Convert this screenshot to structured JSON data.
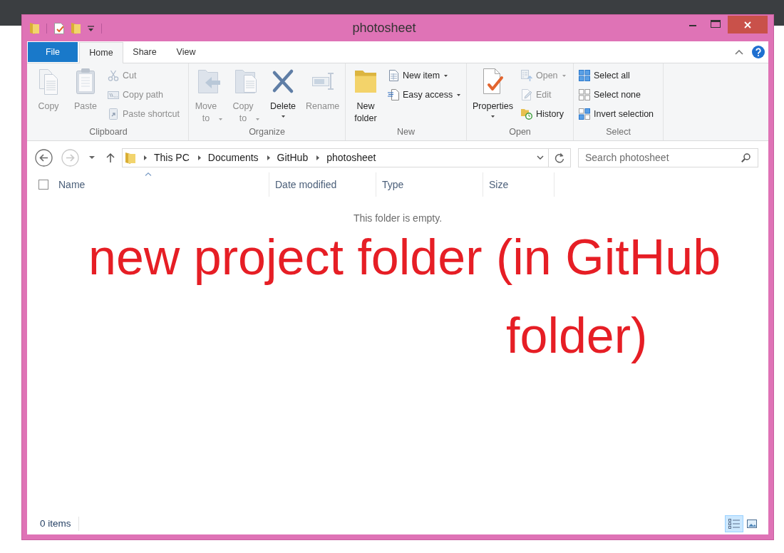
{
  "window": {
    "title": "photosheet"
  },
  "tabs": [
    {
      "label": "File",
      "kind": "file",
      "selected": false
    },
    {
      "label": "Home",
      "kind": "tab",
      "selected": true
    },
    {
      "label": "Share",
      "kind": "tab",
      "selected": false
    },
    {
      "label": "View",
      "kind": "tab",
      "selected": false
    }
  ],
  "ribbon": {
    "groups": [
      {
        "label": "Clipboard",
        "columns": [
          {
            "kind": "large",
            "label": "Copy",
            "disabled": true
          },
          {
            "kind": "large",
            "label": "Paste",
            "disabled": true
          },
          {
            "kind": "stack",
            "items": [
              {
                "label": "Cut",
                "disabled": true,
                "dropdown": false
              },
              {
                "label": "Copy path",
                "disabled": true,
                "dropdown": false
              },
              {
                "label": "Paste shortcut",
                "disabled": true,
                "dropdown": false
              }
            ]
          }
        ]
      },
      {
        "label": "Organize",
        "columns": [
          {
            "kind": "dropdown",
            "label": "Move to",
            "disabled": true
          },
          {
            "kind": "dropdown",
            "label": "Copy to",
            "disabled": true
          },
          {
            "kind": "split",
            "label": "Delete",
            "disabled": false
          },
          {
            "kind": "large",
            "label": "Rename",
            "disabled": true
          }
        ]
      },
      {
        "label": "New",
        "columns": [
          {
            "kind": "large",
            "label": "New folder",
            "disabled": false
          },
          {
            "kind": "stack",
            "items": [
              {
                "label": "New item",
                "disabled": false,
                "dropdown": true
              },
              {
                "label": "Easy access",
                "disabled": false,
                "dropdown": true
              }
            ]
          }
        ]
      },
      {
        "label": "Open",
        "columns": [
          {
            "kind": "split",
            "label": "Properties",
            "disabled": false
          },
          {
            "kind": "stack",
            "items": [
              {
                "label": "Open",
                "disabled": true,
                "dropdown": true
              },
              {
                "label": "Edit",
                "disabled": true,
                "dropdown": false
              },
              {
                "label": "History",
                "disabled": false,
                "dropdown": false
              }
            ]
          }
        ]
      },
      {
        "label": "Select",
        "columns": [
          {
            "kind": "stack",
            "items": [
              {
                "label": "Select all",
                "disabled": false,
                "dropdown": false
              },
              {
                "label": "Select none",
                "disabled": false,
                "dropdown": false
              },
              {
                "label": "Invert selection",
                "disabled": false,
                "dropdown": false
              }
            ]
          }
        ]
      }
    ]
  },
  "navigation": {
    "back": {
      "disabled": false
    },
    "forward": {
      "disabled": true
    }
  },
  "address": {
    "breadcrumbs": [
      "This PC",
      "Documents",
      "GitHub",
      "photosheet"
    ]
  },
  "search": {
    "placeholder": "Search photosheet"
  },
  "file_list": {
    "select_all": {
      "checked": false
    },
    "columns": [
      {
        "label": "Name",
        "sorted": true
      },
      {
        "label": "Date modified",
        "sorted": false
      },
      {
        "label": "Type",
        "sorted": false
      },
      {
        "label": "Size",
        "sorted": false
      }
    ],
    "empty_message": "This folder is empty."
  },
  "annotation": {
    "lines": [
      "new project folder (in GitHub",
      "folder)"
    ]
  },
  "status_bar": {
    "item_count": "0 items",
    "views": [
      {
        "selected": true
      },
      {
        "selected": false
      }
    ]
  }
}
